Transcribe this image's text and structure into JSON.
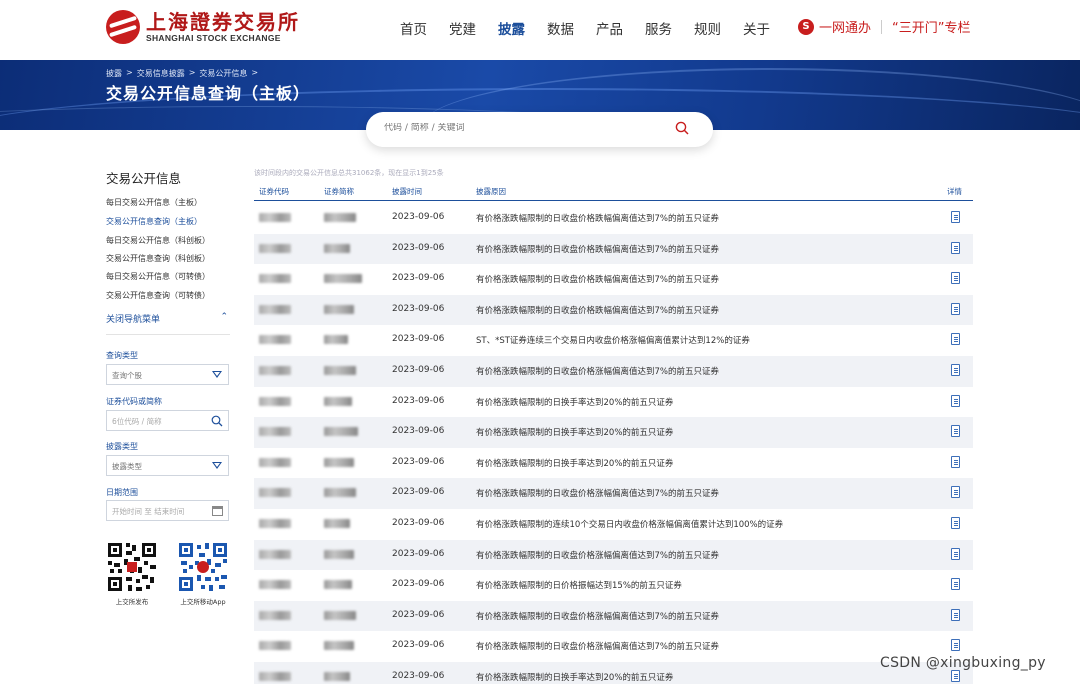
{
  "header": {
    "logo_cn": "上海證券交易所",
    "logo_en": "SHANGHAI STOCK EXCHANGE",
    "nav": [
      "首页",
      "党建",
      "披露",
      "数据",
      "产品",
      "服务",
      "规则",
      "关于"
    ],
    "nav_active_index": 2,
    "quick_links": [
      "一网通办",
      "“三开门”专栏"
    ]
  },
  "breadcrumb": [
    "披露",
    "交易信息披露",
    "交易公开信息"
  ],
  "page_title": "交易公开信息查询（主板）",
  "search": {
    "placeholder": "代码 / 简称 / 关键词"
  },
  "sidebar": {
    "title": "交易公开信息",
    "items": [
      "每日交易公开信息（主板）",
      "交易公开信息查询（主板）",
      "每日交易公开信息（科创板）",
      "交易公开信息查询（科创板）",
      "每日交易公开信息（可转债）",
      "交易公开信息查询（可转债）"
    ],
    "active_index": 1,
    "collapse_label": "关闭导航菜单",
    "filters": {
      "query_type_label": "查询类型",
      "query_type_value": "查询个股",
      "code_label": "证券代码或简称",
      "code_placeholder": "6位代码 / 简称",
      "disclosure_type_label": "披露类型",
      "disclosure_type_value": "披露类型",
      "date_label": "日期范围",
      "date_placeholder": "开始时间  至  结束时间"
    },
    "qr_labels": [
      "上交所发布",
      "上交所移动App"
    ]
  },
  "table": {
    "summary": "该时间段内的交易公开信息总共31062条，现在显示1到25条",
    "headers": [
      "证券代码",
      "证券简称",
      "披露时间",
      "披露原因",
      "详情"
    ],
    "rows": [
      {
        "date": "2023-09-06",
        "reason": "有价格涨跌幅限制的日收盘价格跌幅偏离值达到7%的前五只证券"
      },
      {
        "date": "2023-09-06",
        "reason": "有价格涨跌幅限制的日收盘价格跌幅偏离值达到7%的前五只证券"
      },
      {
        "date": "2023-09-06",
        "reason": "有价格涨跌幅限制的日收盘价格跌幅偏离值达到7%的前五只证券"
      },
      {
        "date": "2023-09-06",
        "reason": "有价格涨跌幅限制的日收盘价格跌幅偏离值达到7%的前五只证券"
      },
      {
        "date": "2023-09-06",
        "reason": "ST、*ST证券连续三个交易日内收盘价格涨幅偏离值累计达到12%的证券"
      },
      {
        "date": "2023-09-06",
        "reason": "有价格涨跌幅限制的日收盘价格涨幅偏离值达到7%的前五只证券"
      },
      {
        "date": "2023-09-06",
        "reason": "有价格涨跌幅限制的日换手率达到20%的前五只证券"
      },
      {
        "date": "2023-09-06",
        "reason": "有价格涨跌幅限制的日换手率达到20%的前五只证券"
      },
      {
        "date": "2023-09-06",
        "reason": "有价格涨跌幅限制的日换手率达到20%的前五只证券"
      },
      {
        "date": "2023-09-06",
        "reason": "有价格涨跌幅限制的日收盘价格涨幅偏离值达到7%的前五只证券"
      },
      {
        "date": "2023-09-06",
        "reason": "有价格涨跌幅限制的连续10个交易日内收盘价格涨幅偏离值累计达到100%的证券"
      },
      {
        "date": "2023-09-06",
        "reason": "有价格涨跌幅限制的日收盘价格涨幅偏离值达到7%的前五只证券"
      },
      {
        "date": "2023-09-06",
        "reason": "有价格涨跌幅限制的日价格振幅达到15%的前五只证券"
      },
      {
        "date": "2023-09-06",
        "reason": "有价格涨跌幅限制的日收盘价格涨幅偏离值达到7%的前五只证券"
      },
      {
        "date": "2023-09-06",
        "reason": "有价格涨跌幅限制的日收盘价格涨幅偏离值达到7%的前五只证券"
      },
      {
        "date": "2023-09-06",
        "reason": "有价格涨跌幅限制的日换手率达到20%的前五只证券"
      }
    ]
  },
  "watermark": "CSDN @xingbuxing_py"
}
